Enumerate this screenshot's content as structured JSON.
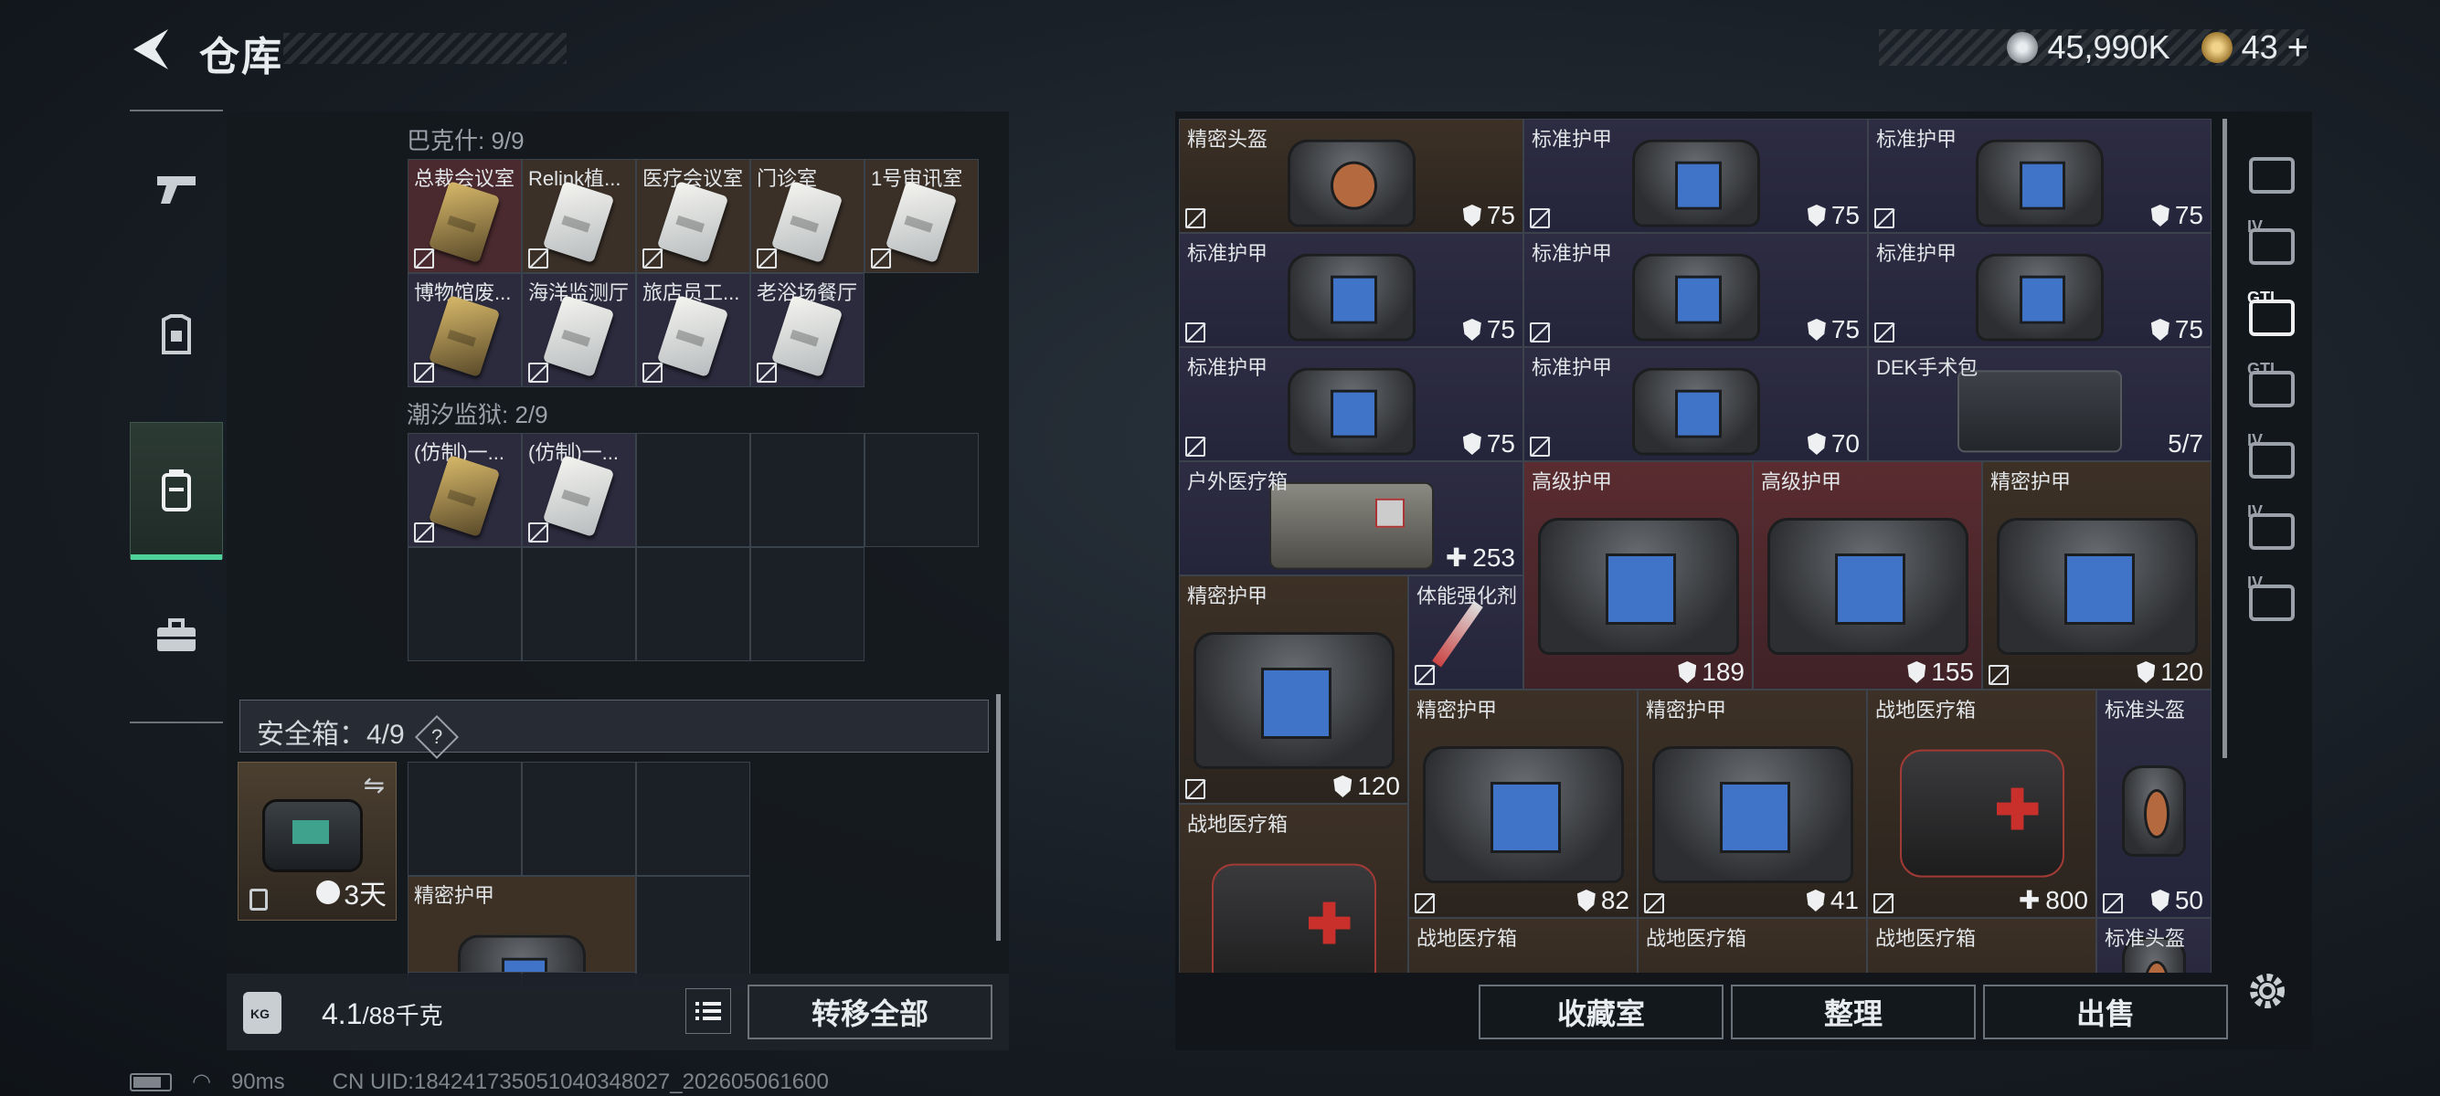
{
  "header": {
    "title": "仓库",
    "currency1": "45,990K",
    "currency2": "43"
  },
  "left_panel": {
    "group1": {
      "title": "巴克什: 9/9",
      "items": [
        "总裁会议室",
        "Relink植...",
        "医疗会议室",
        "门诊室",
        "1号审讯室",
        "博物馆废...",
        "海洋监测厅",
        "旅店员工...",
        "老浴场餐厅"
      ]
    },
    "group2": {
      "title": "潮汐监狱: 2/9",
      "items": [
        "(仿制)一...",
        "(仿制)一..."
      ]
    },
    "safebox": {
      "label": "安全箱：4/9",
      "help": "?",
      "timer": "3天",
      "item": "精密护甲"
    },
    "weight": {
      "current": "4.1",
      "max": "/88千克",
      "icon_label": "KG"
    },
    "transfer_label": "转移全部"
  },
  "right_panel": {
    "items": [
      {
        "name": "精密头盔",
        "value": "75",
        "color": "brown",
        "kind": "helm"
      },
      {
        "name": "标准护甲",
        "value": "75",
        "color": "purple",
        "kind": "bag"
      },
      {
        "name": "标准护甲",
        "value": "75",
        "color": "purple",
        "kind": "bag"
      },
      {
        "name": "标准护甲",
        "value": "75",
        "color": "purple",
        "kind": "bag"
      },
      {
        "name": "标准护甲",
        "value": "75",
        "color": "purple",
        "kind": "bag"
      },
      {
        "name": "标准护甲",
        "value": "75",
        "color": "purple",
        "kind": "bag"
      },
      {
        "name": "标准护甲",
        "value": "75",
        "color": "purple",
        "kind": "bag"
      },
      {
        "name": "标准护甲",
        "value": "70",
        "color": "purple",
        "kind": "bag"
      },
      {
        "name": "DEK手术包",
        "value": "5/7",
        "color": "purple",
        "kind": "surg"
      },
      {
        "name": "户外医疗箱",
        "value": "253",
        "color": "purple",
        "kind": "pouch"
      },
      {
        "name": "高级护甲",
        "value": "189",
        "color": "red",
        "kind": "bigbag"
      },
      {
        "name": "高级护甲",
        "value": "155",
        "color": "red",
        "kind": "bigbag"
      },
      {
        "name": "精密护甲",
        "value": "120",
        "color": "brown",
        "kind": "bigbag"
      },
      {
        "name": "精密护甲",
        "value": "120",
        "color": "brown",
        "kind": "bigbag"
      },
      {
        "name": "体能强化剂",
        "value": "",
        "color": "purple",
        "kind": "syringe"
      },
      {
        "name": "精密护甲",
        "value": "82",
        "color": "brown",
        "kind": "bigbag"
      },
      {
        "name": "精密护甲",
        "value": "41",
        "color": "brown",
        "kind": "bigbag"
      },
      {
        "name": "战地医疗箱",
        "value": "800",
        "color": "brown",
        "kind": "medkit"
      },
      {
        "name": "标准头盔",
        "value": "50",
        "color": "purple",
        "kind": "helm"
      },
      {
        "name": "战地医疗箱",
        "value": "",
        "color": "brown",
        "kind": "medkit"
      },
      {
        "name": "战地医疗箱",
        "value": "",
        "color": "brown",
        "kind": "medkit"
      },
      {
        "name": "战地医疗箱",
        "value": "",
        "color": "brown",
        "kind": "medkit"
      },
      {
        "name": "战地医疗箱",
        "value": "",
        "color": "brown",
        "kind": "medkit"
      },
      {
        "name": "标准头盔",
        "value": "",
        "color": "purple",
        "kind": "helm"
      }
    ],
    "buttons": {
      "collection": "收藏室",
      "organize": "整理",
      "sell": "出售"
    },
    "rail_labels": [
      "",
      "IV",
      "GTI",
      "GTI",
      "IV",
      "IV",
      "IV"
    ]
  },
  "status": {
    "ping": "90ms",
    "uid": "CN UID:184241735051040348027_202605061600"
  },
  "colors": {
    "accent": "#4fd19a",
    "brown": "#3d3126",
    "purple": "#2d2c42",
    "red": "#5a2c30"
  }
}
